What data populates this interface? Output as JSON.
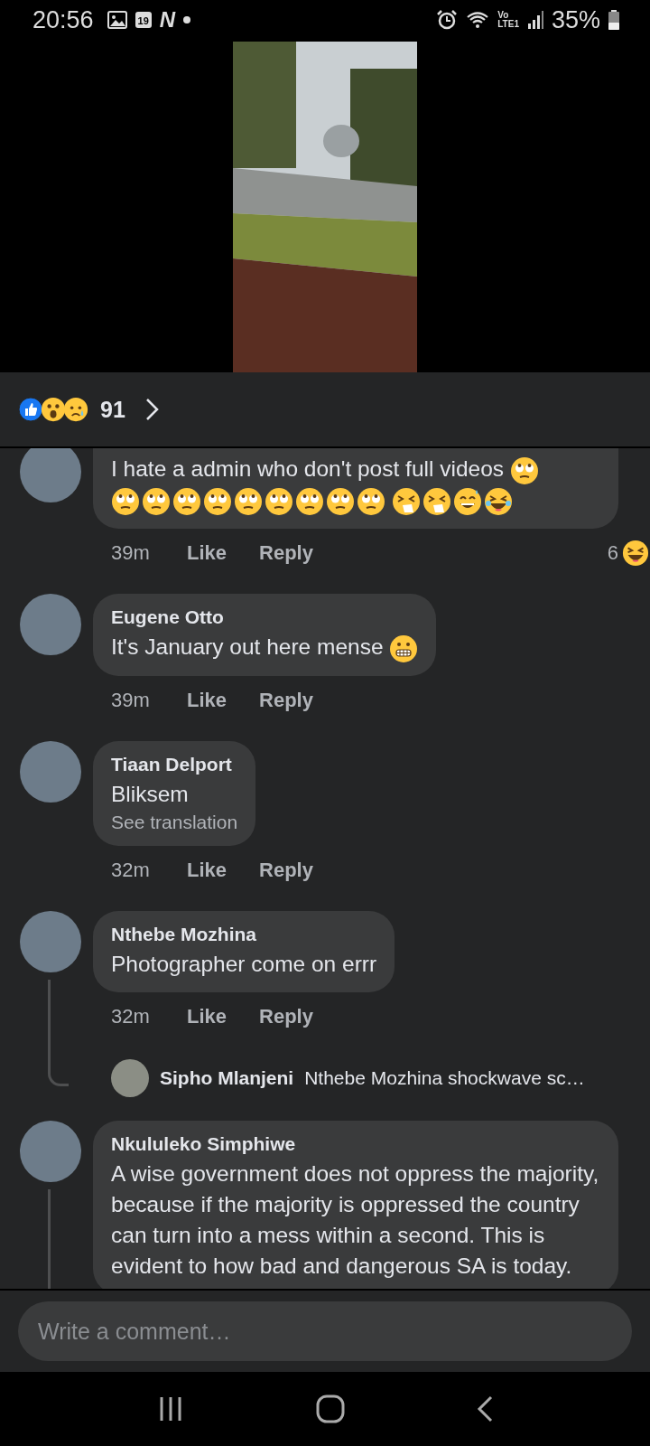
{
  "status_bar": {
    "time": "20:56",
    "calendar_day": "19",
    "app_letter": "N",
    "network_label_top": "Vo",
    "network_label_bottom": "LTE1",
    "battery": "35%"
  },
  "reactions": {
    "count": "91",
    "types": [
      {
        "kind": "like"
      },
      {
        "kind": "wow"
      },
      {
        "kind": "sad"
      }
    ]
  },
  "comments": [
    {
      "cut_off_top": true,
      "text": "I hate a admin who don't post full videos",
      "emoji_groups": [
        [
          {
            "kind": "eye-roll"
          }
        ],
        [
          {
            "kind": "eye-roll"
          },
          {
            "kind": "eye-roll"
          },
          {
            "kind": "eye-roll"
          },
          {
            "kind": "eye-roll"
          },
          {
            "kind": "eye-roll"
          },
          {
            "kind": "eye-roll"
          },
          {
            "kind": "eye-roll"
          },
          {
            "kind": "eye-roll"
          },
          {
            "kind": "eye-roll"
          }
        ],
        [
          {
            "kind": "sneezing"
          },
          {
            "kind": "sneezing"
          },
          {
            "kind": "sweat-smile"
          },
          {
            "kind": "tears-of-joy"
          }
        ]
      ],
      "time": "39m",
      "like": "Like",
      "reply": "Reply",
      "reaction": {
        "count": "6",
        "kind": "laughing"
      },
      "thread": false
    },
    {
      "cut_off_top": false,
      "name": "Eugene Otto",
      "text": "It's January out here mense",
      "emoji_groups": [
        [
          {
            "kind": "grimacing"
          }
        ]
      ],
      "time": "39m",
      "like": "Like",
      "reply": "Reply",
      "thread": false
    },
    {
      "cut_off_top": false,
      "name": "Tiaan Delport",
      "text": "Bliksem",
      "translation_link": "See translation",
      "time": "32m",
      "like": "Like",
      "reply": "Reply",
      "thread": false
    },
    {
      "cut_off_top": false,
      "name": "Nthebe Mozhina",
      "text": "Photographer come on errr",
      "time": "32m",
      "like": "Like",
      "reply": "Reply",
      "thread": true,
      "reply_preview": {
        "name": "Sipho Mlanjeni",
        "text": "Nthebe Mozhina shockwave sc…"
      }
    },
    {
      "cut_off_top": false,
      "name": "Nkululeko Simphiwe",
      "text": "A wise government does not oppress the majority, because if the majority is oppressed the country can turn into a mess within a second. This is evident to how bad and dangerous SA is today.",
      "thread": true
    }
  ],
  "comment_input": {
    "placeholder": "Write a comment…"
  }
}
